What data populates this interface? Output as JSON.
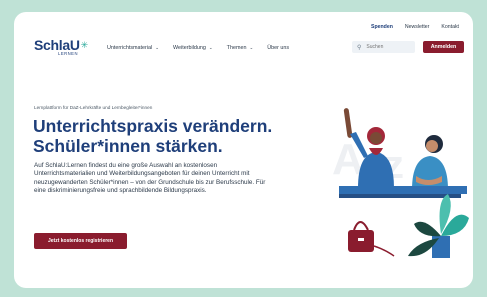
{
  "meta_nav": {
    "donate": "Spenden",
    "newsletter": "Newsletter",
    "contact": "Kontakt"
  },
  "logo": {
    "main": "SchlaU",
    "sub": "LERNEN"
  },
  "main_nav": {
    "items": [
      {
        "label": "Unterrichtsmaterial",
        "has_dropdown": true
      },
      {
        "label": "Weiterbildung",
        "has_dropdown": true
      },
      {
        "label": "Themen",
        "has_dropdown": true
      },
      {
        "label": "Über uns",
        "has_dropdown": false
      }
    ]
  },
  "search": {
    "placeholder": "Suchen"
  },
  "login_label": "Anmelden",
  "hero": {
    "eyebrow": "Lernplattform für DaZ-Lehrkräfte und Lernbegleiter*innen",
    "headline": "Unterrichtspraxis verändern. Schüler*innen stärken.",
    "intro": "Auf SchlaU:Lernen findest du eine große Auswahl an kostenlosen Unterrichtsmaterialien und Weiterbildungsangeboten für deinen Unterricht mit neuzugewanderten Schüler*innen – von der Grundschule bis zur Berufsschule. Für eine diskriminierungsfreie und sprachbildende Bildungspraxis.",
    "cta": "Jetzt kostenlos registrieren"
  },
  "colors": {
    "brand_blue": "#1f3f7a",
    "accent_red": "#8a1c2e",
    "teal": "#2aa99a",
    "background": "#bfe2d6"
  }
}
